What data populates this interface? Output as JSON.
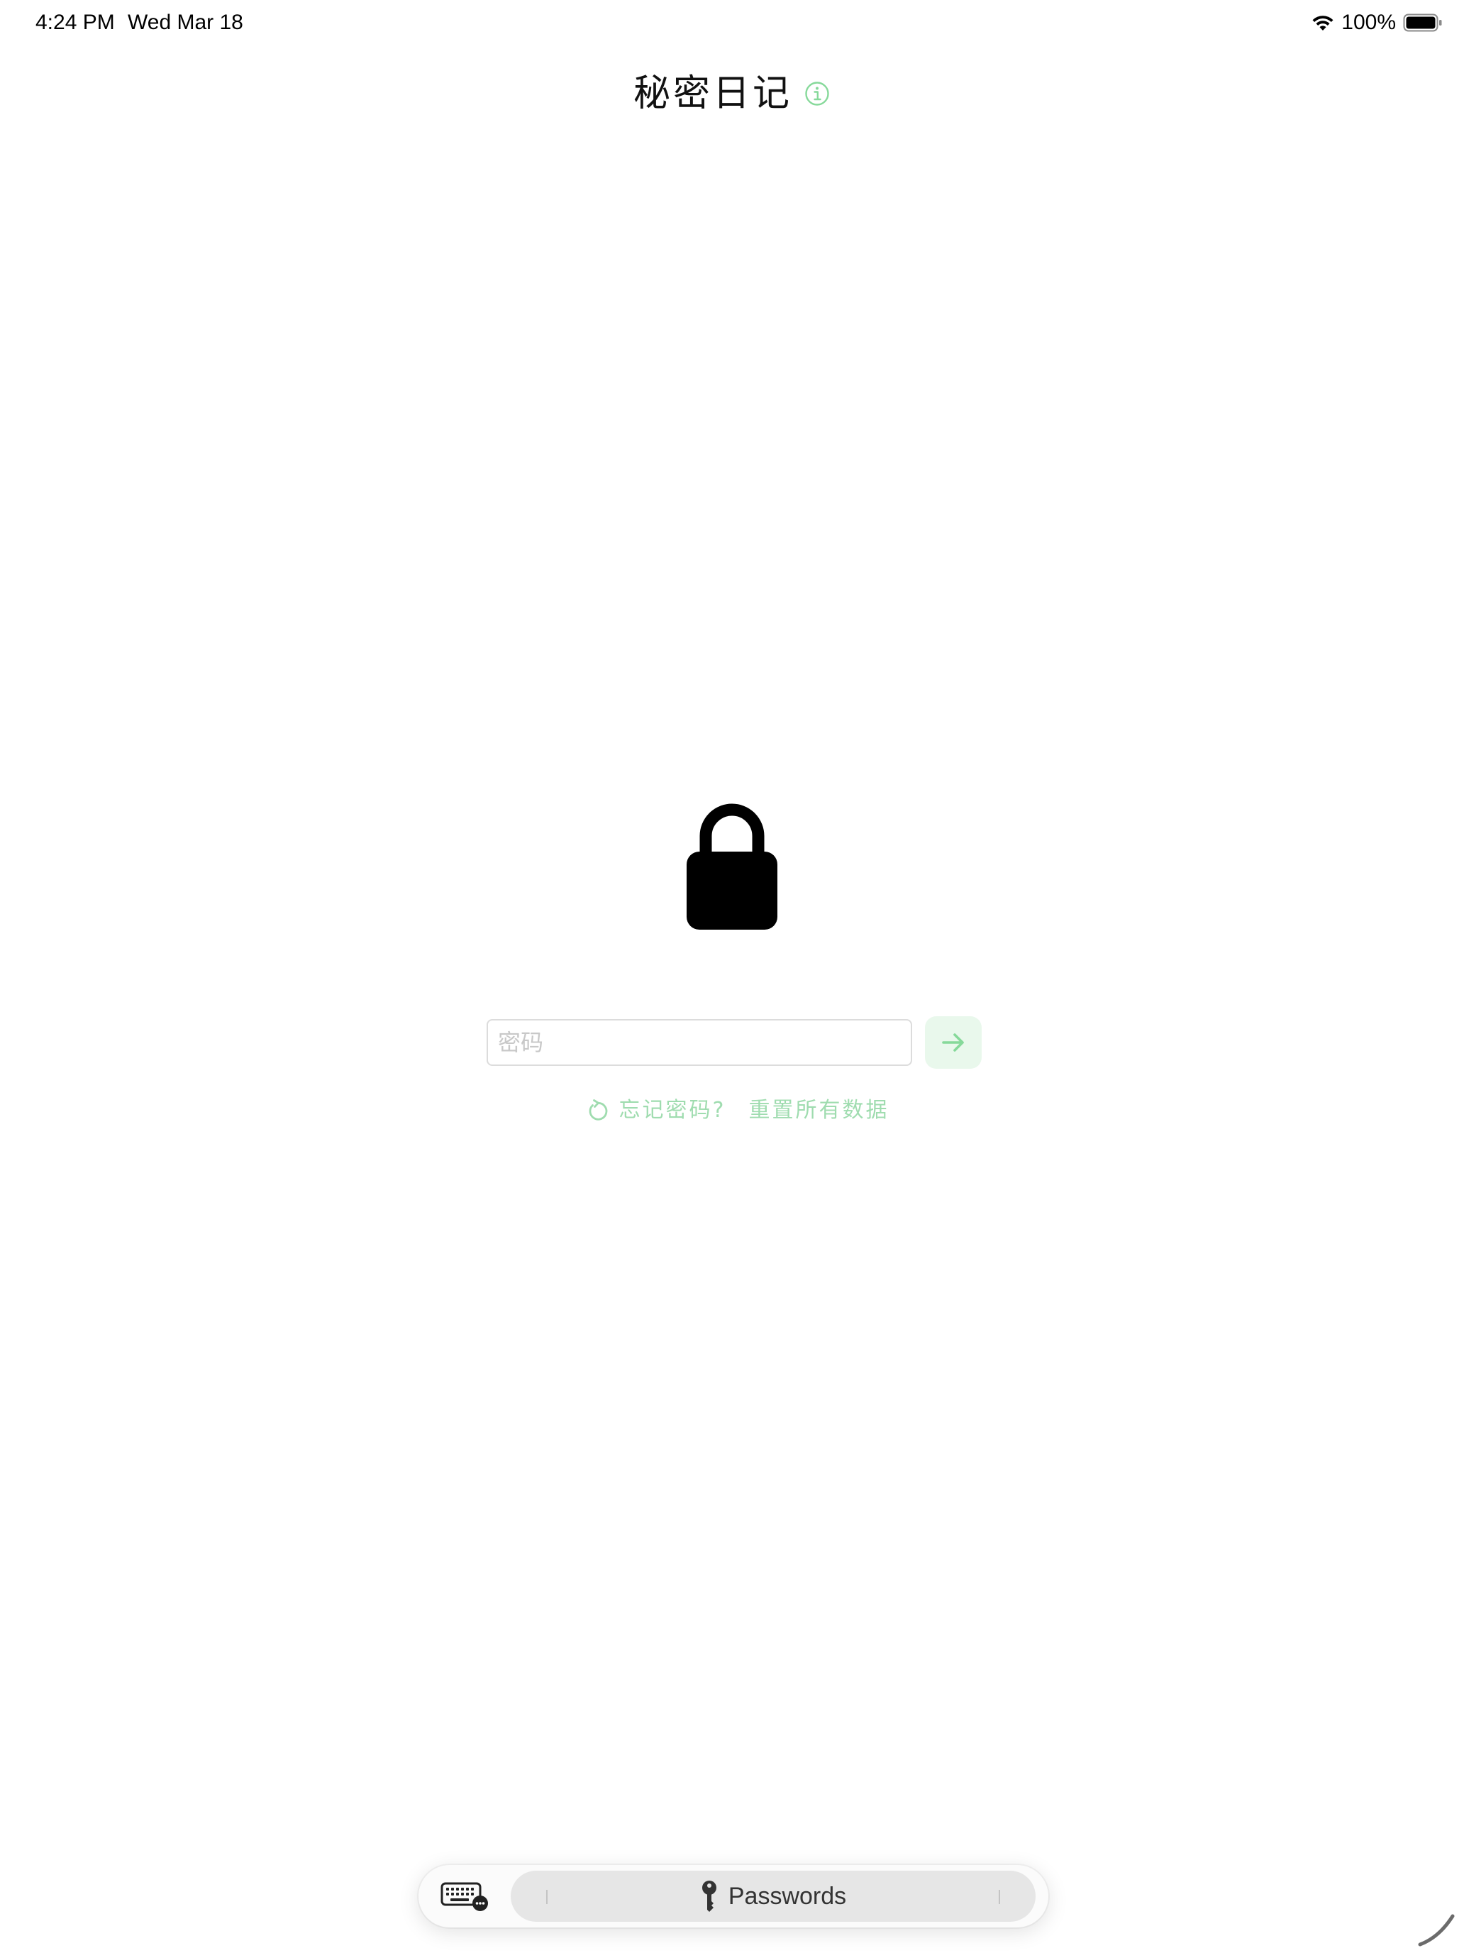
{
  "status_bar": {
    "time": "4:24 PM",
    "date": "Wed Mar 18",
    "battery": "100%",
    "icons": [
      "wifi-icon",
      "battery-icon"
    ]
  },
  "header": {
    "title": "秘密日记",
    "info_icon": "info-circle-icon"
  },
  "lock": {
    "icon": "lock-icon"
  },
  "login": {
    "password_placeholder": "密码",
    "password_value": "",
    "submit_icon": "arrow-right-icon"
  },
  "recovery": {
    "icon": "counterclockwise-arrow-icon",
    "forgot_text": "忘记密码?",
    "reset_link": "重置所有数据"
  },
  "keyboard_bar": {
    "keyboard_icon": "keyboard-icon",
    "passwords_icon": "key-icon",
    "passwords_label": "Passwords"
  },
  "colors": {
    "accent": "#86d99a",
    "accent_light": "#e9f8ec",
    "text": "#111111",
    "placeholder": "#c8c8c8"
  }
}
